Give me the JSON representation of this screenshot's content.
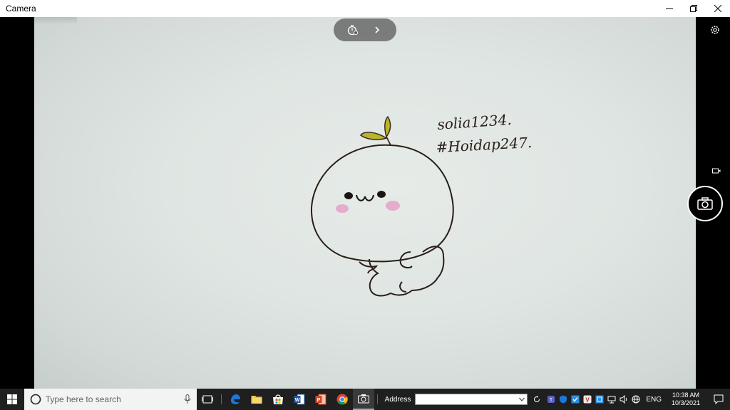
{
  "window": {
    "title": "Camera",
    "controls": [
      "minimize-icon",
      "restore-icon",
      "close-icon"
    ]
  },
  "camera": {
    "top_pill": [
      "timer-icon",
      "chevron-right-icon"
    ],
    "right_controls": [
      "settings-icon",
      "video-mode-icon",
      "camera-shutter-icon"
    ],
    "preview_handwriting": {
      "line1": "solia1234.",
      "line2": "#Hoidap247."
    }
  },
  "taskbar": {
    "search_placeholder": "Type here to search",
    "pinned_apps": [
      "task-view-icon",
      "edge-icon",
      "file-explorer-icon",
      "store-icon",
      "word-icon",
      "powerpoint-icon",
      "chrome-icon",
      "camera-app-icon"
    ],
    "address_label": "Address",
    "tray_language": "ENG",
    "clock_time": "10:38 AM",
    "clock_date": "10/3/2021"
  },
  "colors": {
    "taskbar_bg": "#1f1f1f",
    "edge_blue": "#1e78d7",
    "word_blue": "#2b579a",
    "ppt_orange": "#d24726",
    "accent": "#0078d7"
  }
}
